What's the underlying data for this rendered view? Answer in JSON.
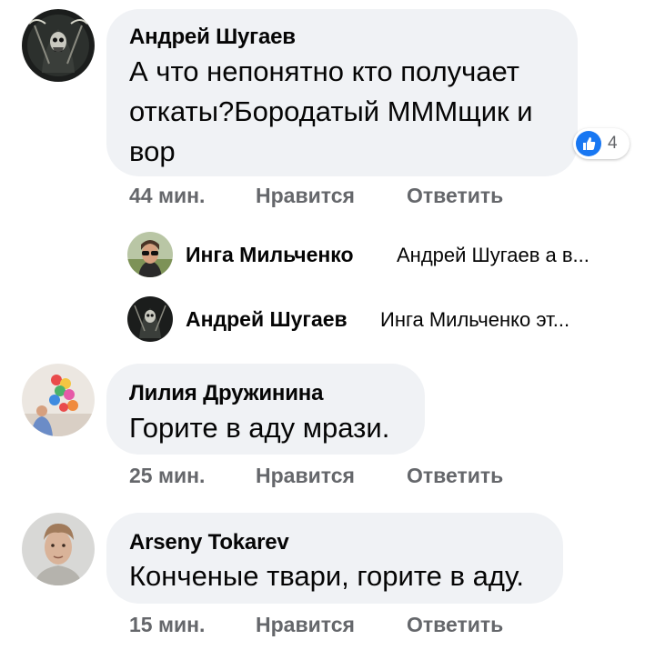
{
  "comments": [
    {
      "author": "Андрей Шугаев",
      "lines": [
        "А что непонятно кто получает",
        "откаты?Бородатый МММщик и",
        "вор"
      ],
      "time": "44 мин.",
      "like_label": "Нравится",
      "reply_label": "Ответить",
      "reaction_count": "4"
    },
    {
      "author": "Лилия Дружинина",
      "lines": [
        "Горите в аду мрази."
      ],
      "time": "25 мин.",
      "like_label": "Нравится",
      "reply_label": "Ответить"
    },
    {
      "author": "Arseny Tokarev",
      "lines": [
        "Конченые твари, горите в аду."
      ],
      "time": "15 мин.",
      "like_label": "Нравится",
      "reply_label": "Ответить"
    }
  ],
  "replies": [
    {
      "author": "Инга Мильченко",
      "preview": "Андрей Шугаев а в..."
    },
    {
      "author": "Андрей Шугаев",
      "preview": "Инга Мильченко  эт..."
    }
  ],
  "colors": {
    "bubble": "#f0f2f5",
    "action_text": "#65676b",
    "like_blue": "#1877f2"
  }
}
